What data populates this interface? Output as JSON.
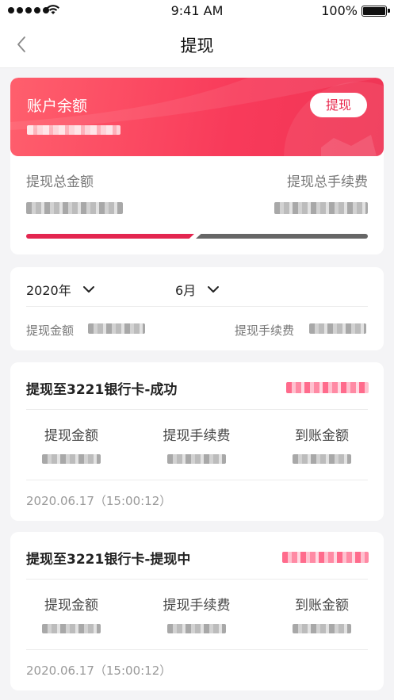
{
  "status_bar": {
    "time": "9:41 AM",
    "battery": "100%"
  },
  "nav": {
    "title": "提现"
  },
  "balance": {
    "label": "账户余额",
    "withdraw_button": "提现",
    "total_amount_label": "提现总金额",
    "total_fee_label": "提现总手续费",
    "withdrawn_fraction": 0.5
  },
  "filter": {
    "year": "2020年",
    "month": "6月",
    "amount_label": "提现金额",
    "fee_label": "提现手续费"
  },
  "records": [
    {
      "title": "提现至3221银行卡-成功",
      "col_amount": "提现金额",
      "col_fee": "提现手续费",
      "col_received": "到账金额",
      "time": "2020.06.17（15:00:12）"
    },
    {
      "title": "提现至3221银行卡-提现中",
      "col_amount": "提现金额",
      "col_fee": "提现手续费",
      "col_received": "到账金额",
      "time": "2020.06.17（15:00:12）"
    }
  ],
  "colors": {
    "accent": "#f83a5a",
    "accent_dark": "#e32650",
    "grey_bar": "#666666"
  }
}
